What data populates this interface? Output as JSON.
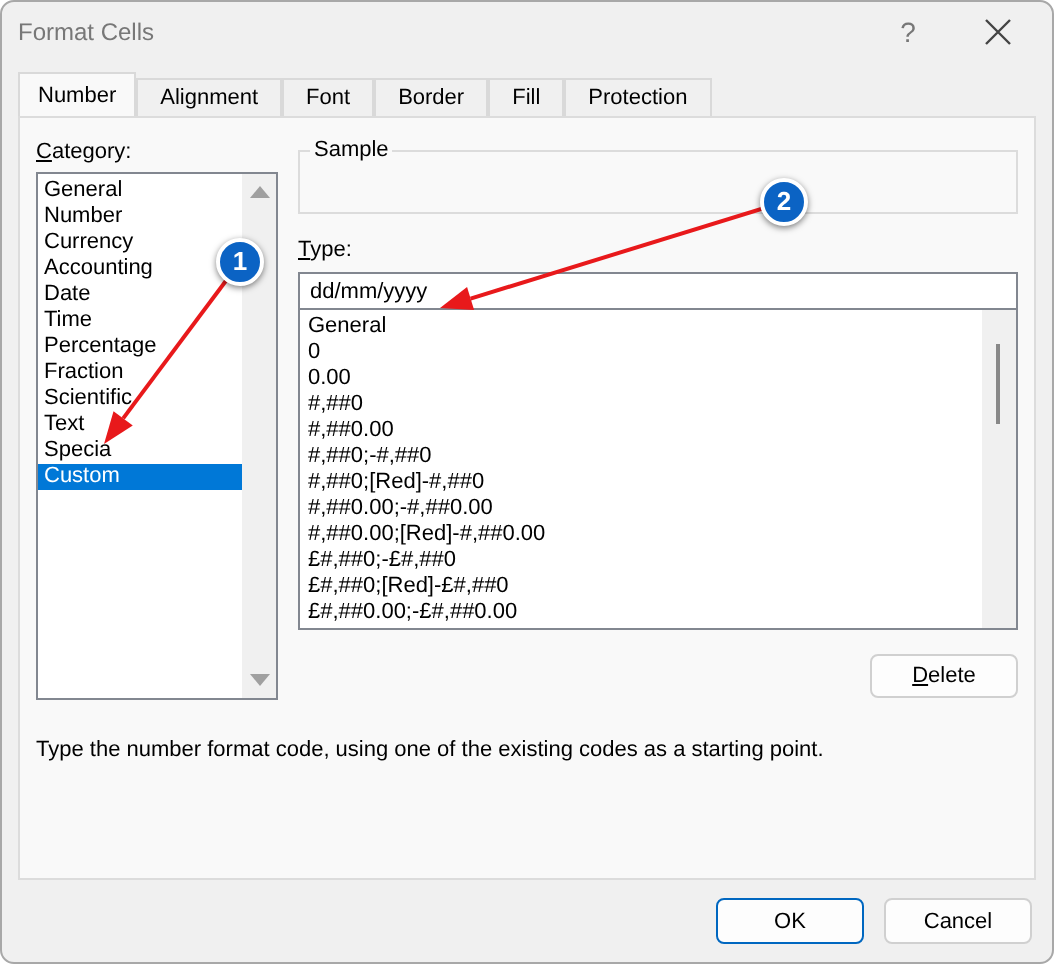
{
  "window": {
    "title": "Format Cells",
    "help": "?"
  },
  "tabs": [
    {
      "label": "Number",
      "selected": true
    },
    {
      "label": "Alignment",
      "selected": false
    },
    {
      "label": "Font",
      "selected": false
    },
    {
      "label": "Border",
      "selected": false
    },
    {
      "label": "Fill",
      "selected": false
    },
    {
      "label": "Protection",
      "selected": false
    }
  ],
  "category": {
    "label": "Category:",
    "items": [
      {
        "label": "General",
        "selected": false
      },
      {
        "label": "Number",
        "selected": false
      },
      {
        "label": "Currency",
        "selected": false
      },
      {
        "label": "Accounting",
        "selected": false
      },
      {
        "label": "Date",
        "selected": false
      },
      {
        "label": "Time",
        "selected": false
      },
      {
        "label": "Percentage",
        "selected": false
      },
      {
        "label": "Fraction",
        "selected": false
      },
      {
        "label": "Scientific",
        "selected": false
      },
      {
        "label": "Text",
        "selected": false
      },
      {
        "label": "Specia",
        "selected": false
      },
      {
        "label": "Custom",
        "selected": true
      }
    ]
  },
  "sample": {
    "label": "Sample"
  },
  "type": {
    "label": "Type:",
    "value": "dd/mm/yyyy",
    "items": [
      "General",
      "0",
      "0.00",
      "#,##0",
      "#,##0.00",
      "#,##0;-#,##0",
      "#,##0;[Red]-#,##0",
      "#,##0.00;-#,##0.00",
      "#,##0.00;[Red]-#,##0.00",
      "£#,##0;-£#,##0",
      "£#,##0;[Red]-£#,##0",
      "£#,##0.00;-£#,##0.00"
    ]
  },
  "delete_button": "Delete",
  "description": "Type the number format code, using one of the existing codes as a starting point.",
  "buttons": [
    {
      "label": "OK",
      "default": true
    },
    {
      "label": "Cancel",
      "default": false
    }
  ],
  "annotations": [
    {
      "label": "1"
    },
    {
      "label": "2"
    }
  ]
}
